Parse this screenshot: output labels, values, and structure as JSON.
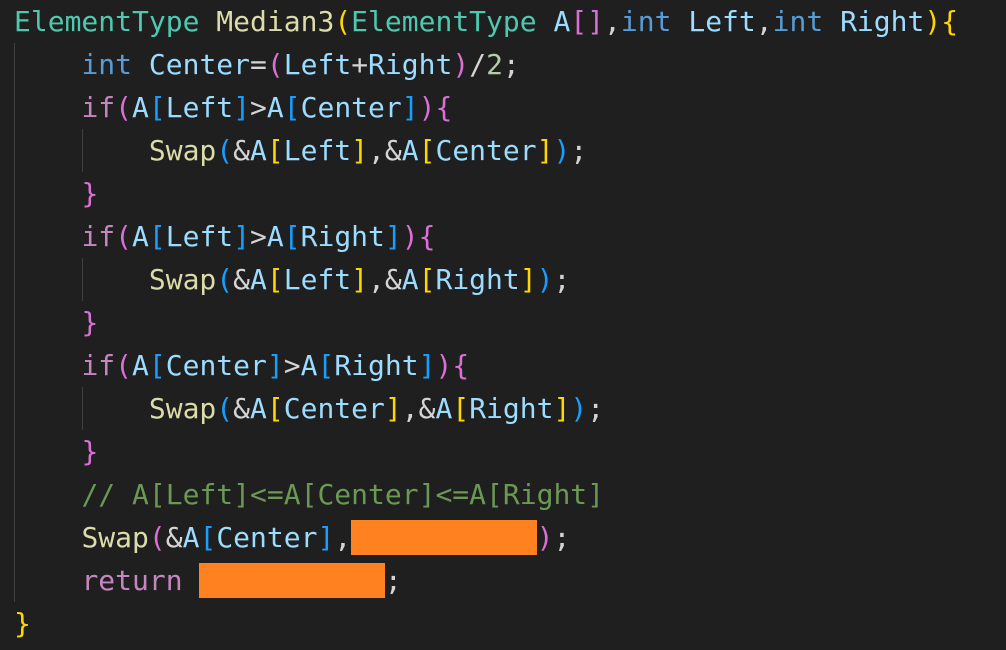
{
  "code": {
    "lines": [
      [
        {
          "t": "ElementType",
          "c": "tok-type"
        },
        {
          "t": " ",
          "c": "tok-op"
        },
        {
          "t": "Median3",
          "c": "tok-fn"
        },
        {
          "t": "(",
          "c": "b1"
        },
        {
          "t": "ElementType",
          "c": "tok-type"
        },
        {
          "t": " ",
          "c": "tok-op"
        },
        {
          "t": "A",
          "c": "tok-var"
        },
        {
          "t": "[]",
          "c": "b2"
        },
        {
          "t": ",",
          "c": "tok-op"
        },
        {
          "t": "int",
          "c": "tok-kw"
        },
        {
          "t": " ",
          "c": "tok-op"
        },
        {
          "t": "Left",
          "c": "tok-var"
        },
        {
          "t": ",",
          "c": "tok-op"
        },
        {
          "t": "int",
          "c": "tok-kw"
        },
        {
          "t": " ",
          "c": "tok-op"
        },
        {
          "t": "Right",
          "c": "tok-var"
        },
        {
          "t": ")",
          "c": "b1"
        },
        {
          "t": "{",
          "c": "b1"
        }
      ],
      [
        {
          "t": "    ",
          "c": "tok-op"
        },
        {
          "t": "int",
          "c": "tok-kw"
        },
        {
          "t": " ",
          "c": "tok-op"
        },
        {
          "t": "Center",
          "c": "tok-var"
        },
        {
          "t": "=",
          "c": "tok-op"
        },
        {
          "t": "(",
          "c": "b2"
        },
        {
          "t": "Left",
          "c": "tok-var"
        },
        {
          "t": "+",
          "c": "tok-op"
        },
        {
          "t": "Right",
          "c": "tok-var"
        },
        {
          "t": ")",
          "c": "b2"
        },
        {
          "t": "/",
          "c": "tok-op"
        },
        {
          "t": "2",
          "c": "tok-num"
        },
        {
          "t": ";",
          "c": "tok-op"
        }
      ],
      [
        {
          "t": "    ",
          "c": "tok-op"
        },
        {
          "t": "if",
          "c": "tok-ctrl"
        },
        {
          "t": "(",
          "c": "b2"
        },
        {
          "t": "A",
          "c": "tok-var"
        },
        {
          "t": "[",
          "c": "b3"
        },
        {
          "t": "Left",
          "c": "tok-var"
        },
        {
          "t": "]",
          "c": "b3"
        },
        {
          "t": ">",
          "c": "tok-op"
        },
        {
          "t": "A",
          "c": "tok-var"
        },
        {
          "t": "[",
          "c": "b3"
        },
        {
          "t": "Center",
          "c": "tok-var"
        },
        {
          "t": "]",
          "c": "b3"
        },
        {
          "t": ")",
          "c": "b2"
        },
        {
          "t": "{",
          "c": "b2"
        }
      ],
      [
        {
          "t": "        ",
          "c": "tok-op"
        },
        {
          "t": "Swap",
          "c": "tok-fn"
        },
        {
          "t": "(",
          "c": "b3"
        },
        {
          "t": "&",
          "c": "tok-op"
        },
        {
          "t": "A",
          "c": "tok-var"
        },
        {
          "t": "[",
          "c": "b1"
        },
        {
          "t": "Left",
          "c": "tok-var"
        },
        {
          "t": "]",
          "c": "b1"
        },
        {
          "t": ",",
          "c": "tok-op"
        },
        {
          "t": "&",
          "c": "tok-op"
        },
        {
          "t": "A",
          "c": "tok-var"
        },
        {
          "t": "[",
          "c": "b1"
        },
        {
          "t": "Center",
          "c": "tok-var"
        },
        {
          "t": "]",
          "c": "b1"
        },
        {
          "t": ")",
          "c": "b3"
        },
        {
          "t": ";",
          "c": "tok-op"
        }
      ],
      [
        {
          "t": "    ",
          "c": "tok-op"
        },
        {
          "t": "}",
          "c": "b2"
        }
      ],
      [
        {
          "t": "    ",
          "c": "tok-op"
        },
        {
          "t": "if",
          "c": "tok-ctrl"
        },
        {
          "t": "(",
          "c": "b2"
        },
        {
          "t": "A",
          "c": "tok-var"
        },
        {
          "t": "[",
          "c": "b3"
        },
        {
          "t": "Left",
          "c": "tok-var"
        },
        {
          "t": "]",
          "c": "b3"
        },
        {
          "t": ">",
          "c": "tok-op"
        },
        {
          "t": "A",
          "c": "tok-var"
        },
        {
          "t": "[",
          "c": "b3"
        },
        {
          "t": "Right",
          "c": "tok-var"
        },
        {
          "t": "]",
          "c": "b3"
        },
        {
          "t": ")",
          "c": "b2"
        },
        {
          "t": "{",
          "c": "b2"
        }
      ],
      [
        {
          "t": "        ",
          "c": "tok-op"
        },
        {
          "t": "Swap",
          "c": "tok-fn"
        },
        {
          "t": "(",
          "c": "b3"
        },
        {
          "t": "&",
          "c": "tok-op"
        },
        {
          "t": "A",
          "c": "tok-var"
        },
        {
          "t": "[",
          "c": "b1"
        },
        {
          "t": "Left",
          "c": "tok-var"
        },
        {
          "t": "]",
          "c": "b1"
        },
        {
          "t": ",",
          "c": "tok-op"
        },
        {
          "t": "&",
          "c": "tok-op"
        },
        {
          "t": "A",
          "c": "tok-var"
        },
        {
          "t": "[",
          "c": "b1"
        },
        {
          "t": "Right",
          "c": "tok-var"
        },
        {
          "t": "]",
          "c": "b1"
        },
        {
          "t": ")",
          "c": "b3"
        },
        {
          "t": ";",
          "c": "tok-op"
        }
      ],
      [
        {
          "t": "    ",
          "c": "tok-op"
        },
        {
          "t": "}",
          "c": "b2"
        }
      ],
      [
        {
          "t": "    ",
          "c": "tok-op"
        },
        {
          "t": "if",
          "c": "tok-ctrl"
        },
        {
          "t": "(",
          "c": "b2"
        },
        {
          "t": "A",
          "c": "tok-var"
        },
        {
          "t": "[",
          "c": "b3"
        },
        {
          "t": "Center",
          "c": "tok-var"
        },
        {
          "t": "]",
          "c": "b3"
        },
        {
          "t": ">",
          "c": "tok-op"
        },
        {
          "t": "A",
          "c": "tok-var"
        },
        {
          "t": "[",
          "c": "b3"
        },
        {
          "t": "Right",
          "c": "tok-var"
        },
        {
          "t": "]",
          "c": "b3"
        },
        {
          "t": ")",
          "c": "b2"
        },
        {
          "t": "{",
          "c": "b2"
        }
      ],
      [
        {
          "t": "        ",
          "c": "tok-op"
        },
        {
          "t": "Swap",
          "c": "tok-fn"
        },
        {
          "t": "(",
          "c": "b3"
        },
        {
          "t": "&",
          "c": "tok-op"
        },
        {
          "t": "A",
          "c": "tok-var"
        },
        {
          "t": "[",
          "c": "b1"
        },
        {
          "t": "Center",
          "c": "tok-var"
        },
        {
          "t": "]",
          "c": "b1"
        },
        {
          "t": ",",
          "c": "tok-op"
        },
        {
          "t": "&",
          "c": "tok-op"
        },
        {
          "t": "A",
          "c": "tok-var"
        },
        {
          "t": "[",
          "c": "b1"
        },
        {
          "t": "Right",
          "c": "tok-var"
        },
        {
          "t": "]",
          "c": "b1"
        },
        {
          "t": ")",
          "c": "b3"
        },
        {
          "t": ";",
          "c": "tok-op"
        }
      ],
      [
        {
          "t": "    ",
          "c": "tok-op"
        },
        {
          "t": "}",
          "c": "b2"
        }
      ],
      [
        {
          "t": "    ",
          "c": "tok-op"
        },
        {
          "t": "// A[Left]<=A[Center]<=A[Right]",
          "c": "tok-cm"
        }
      ],
      [
        {
          "t": "    ",
          "c": "tok-op"
        },
        {
          "t": "Swap",
          "c": "tok-fn"
        },
        {
          "t": "(",
          "c": "b2"
        },
        {
          "t": "&",
          "c": "tok-op"
        },
        {
          "t": "A",
          "c": "tok-var"
        },
        {
          "t": "[",
          "c": "b3"
        },
        {
          "t": "Center",
          "c": "tok-var"
        },
        {
          "t": "]",
          "c": "b3"
        },
        {
          "t": ",",
          "c": "tok-op"
        },
        {
          "redact": 11
        },
        {
          "t": ")",
          "c": "b2"
        },
        {
          "t": ";",
          "c": "tok-op"
        }
      ],
      [
        {
          "t": "    ",
          "c": "tok-op"
        },
        {
          "t": "return",
          "c": "tok-ctrl"
        },
        {
          "t": " ",
          "c": "tok-op"
        },
        {
          "redact": 11
        },
        {
          "t": ";",
          "c": "tok-op"
        }
      ],
      [
        {
          "t": "}",
          "c": "b1"
        }
      ]
    ]
  },
  "theme": {
    "background": "#1f1f1f",
    "redaction_color": "#ff8120"
  }
}
